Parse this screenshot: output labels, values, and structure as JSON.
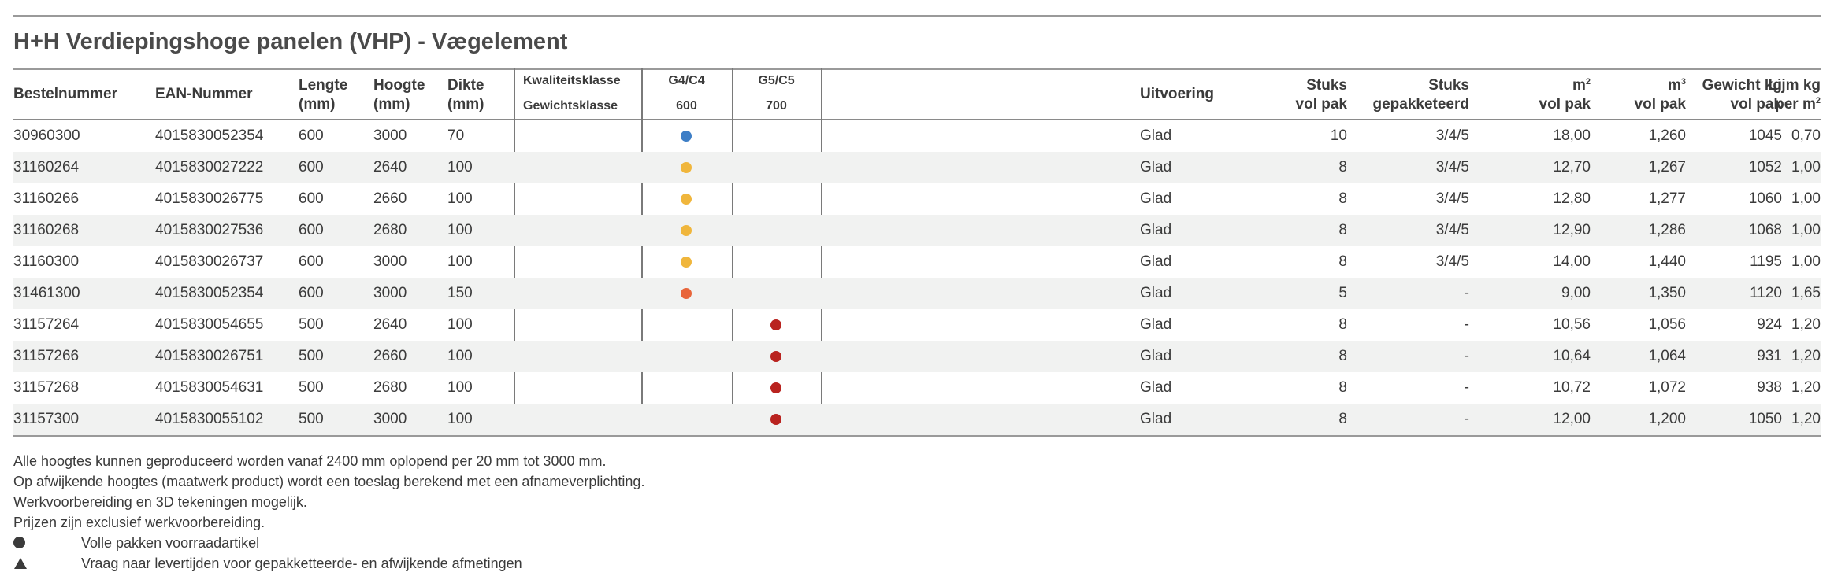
{
  "title": "H+H Verdiepingshoge panelen (VHP) - Vægelement",
  "headers": {
    "bestelnummer": "Bestelnummer",
    "ean": "EAN-Nummer",
    "lengte": [
      "Lengte",
      "(mm)"
    ],
    "hoogte": [
      "Hoogte",
      "(mm)"
    ],
    "dikte": [
      "Dikte",
      "(mm)"
    ],
    "kwaliteitsklasse": "Kwaliteitsklasse",
    "gewichtsklasse": "Gewichtsklasse",
    "g4": "G4/C4",
    "g4_weight": "600",
    "g5": "G5/C5",
    "g5_weight": "700",
    "uitvoering": "Uitvoering",
    "stuks_vol": [
      "Stuks",
      "vol pak"
    ],
    "stuks_gep": [
      "Stuks",
      "gepakketeerd"
    ],
    "m2": [
      "m",
      "2",
      "vol pak"
    ],
    "m3": [
      "m",
      "3",
      "vol pak"
    ],
    "gewicht": [
      "Gewicht kg",
      "vol pak"
    ],
    "lijm": [
      "Lijm kg",
      "per m",
      "2"
    ]
  },
  "colors": {
    "blue": "#3d7ec6",
    "yellow": "#f0b63c",
    "orange": "#e8653a",
    "red": "#b9231f"
  },
  "rows": [
    {
      "bestel": "30960300",
      "ean": "4015830052354",
      "lengte": "600",
      "hoogte": "3000",
      "dikte": "70",
      "g4": "blue",
      "g5": "",
      "uitvoering": "Glad",
      "stuks_vol": "10",
      "stuks_gep": "3/4/5",
      "m2": "18,00",
      "m3": "1,260",
      "gewicht": "1045",
      "lijm": "0,70"
    },
    {
      "bestel": "31160264",
      "ean": "4015830027222",
      "lengte": "600",
      "hoogte": "2640",
      "dikte": "100",
      "g4": "yellow",
      "g5": "",
      "uitvoering": "Glad",
      "stuks_vol": "8",
      "stuks_gep": "3/4/5",
      "m2": "12,70",
      "m3": "1,267",
      "gewicht": "1052",
      "lijm": "1,00"
    },
    {
      "bestel": "31160266",
      "ean": "4015830026775",
      "lengte": "600",
      "hoogte": "2660",
      "dikte": "100",
      "g4": "yellow",
      "g5": "",
      "uitvoering": "Glad",
      "stuks_vol": "8",
      "stuks_gep": "3/4/5",
      "m2": "12,80",
      "m3": "1,277",
      "gewicht": "1060",
      "lijm": "1,00"
    },
    {
      "bestel": "31160268",
      "ean": "4015830027536",
      "lengte": "600",
      "hoogte": "2680",
      "dikte": "100",
      "g4": "yellow",
      "g5": "",
      "uitvoering": "Glad",
      "stuks_vol": "8",
      "stuks_gep": "3/4/5",
      "m2": "12,90",
      "m3": "1,286",
      "gewicht": "1068",
      "lijm": "1,00"
    },
    {
      "bestel": "31160300",
      "ean": "4015830026737",
      "lengte": "600",
      "hoogte": "3000",
      "dikte": "100",
      "g4": "yellow",
      "g5": "",
      "uitvoering": "Glad",
      "stuks_vol": "8",
      "stuks_gep": "3/4/5",
      "m2": "14,00",
      "m3": "1,440",
      "gewicht": "1195",
      "lijm": "1,00"
    },
    {
      "bestel": "31461300",
      "ean": "4015830052354",
      "lengte": "600",
      "hoogte": "3000",
      "dikte": "150",
      "g4": "orange",
      "g5": "",
      "uitvoering": "Glad",
      "stuks_vol": "5",
      "stuks_gep": "-",
      "m2": "9,00",
      "m3": "1,350",
      "gewicht": "1120",
      "lijm": "1,65"
    },
    {
      "bestel": "31157264",
      "ean": "4015830054655",
      "lengte": "500",
      "hoogte": "2640",
      "dikte": "100",
      "g4": "",
      "g5": "red",
      "uitvoering": "Glad",
      "stuks_vol": "8",
      "stuks_gep": "-",
      "m2": "10,56",
      "m3": "1,056",
      "gewicht": "924",
      "lijm": "1,20"
    },
    {
      "bestel": "31157266",
      "ean": "4015830026751",
      "lengte": "500",
      "hoogte": "2660",
      "dikte": "100",
      "g4": "",
      "g5": "red",
      "uitvoering": "Glad",
      "stuks_vol": "8",
      "stuks_gep": "-",
      "m2": "10,64",
      "m3": "1,064",
      "gewicht": "931",
      "lijm": "1,20"
    },
    {
      "bestel": "31157268",
      "ean": "4015830054631",
      "lengte": "500",
      "hoogte": "2680",
      "dikte": "100",
      "g4": "",
      "g5": "red",
      "uitvoering": "Glad",
      "stuks_vol": "8",
      "stuks_gep": "-",
      "m2": "10,72",
      "m3": "1,072",
      "gewicht": "938",
      "lijm": "1,20"
    },
    {
      "bestel": "31157300",
      "ean": "4015830055102",
      "lengte": "500",
      "hoogte": "3000",
      "dikte": "100",
      "g4": "",
      "g5": "red",
      "uitvoering": "Glad",
      "stuks_vol": "8",
      "stuks_gep": "-",
      "m2": "12,00",
      "m3": "1,200",
      "gewicht": "1050",
      "lijm": "1,20"
    }
  ],
  "notes": [
    "Alle hoogtes kunnen geproduceerd worden vanaf 2400 mm oplopend per 20 mm tot 3000 mm.",
    "Op afwijkende hoogtes (maatwerk product) wordt een toeslag berekend met een afnameverplichting.",
    "Werkvoorbereiding en 3D tekeningen mogelijk.",
    "Prijzen zijn exclusief werkvoorbereiding."
  ],
  "legend": [
    {
      "icon": "circle-icon",
      "text": "Volle pakken voorraadartikel"
    },
    {
      "icon": "triangle-icon",
      "text": "Vraag naar levertijden voor gepakketteerde- en afwijkende afmetingen"
    }
  ]
}
